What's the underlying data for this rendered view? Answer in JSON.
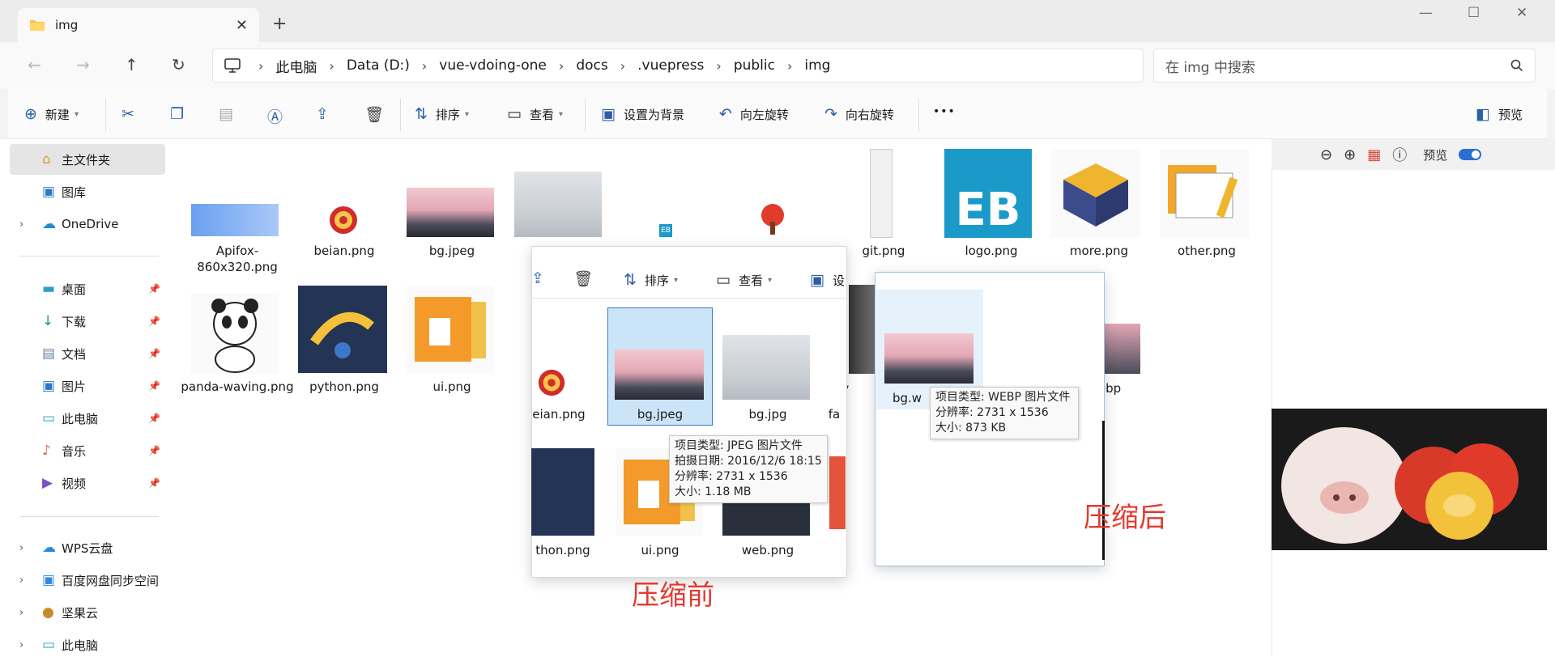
{
  "tab": {
    "title": "img"
  },
  "window_controls": {
    "minimize": "—",
    "maximize": "☐",
    "close": "✕"
  },
  "nav": {
    "back": "←",
    "forward": "→",
    "up": "↑",
    "refresh": "↻"
  },
  "breadcrumb": [
    "此电脑",
    "Data (D:)",
    "vue-vdoing-one",
    "docs",
    ".vuepress",
    "public",
    "img"
  ],
  "search": {
    "placeholder": "在 img 中搜索"
  },
  "toolbar": {
    "new_label": "新建",
    "sort_label": "排序",
    "view_label": "查看",
    "set_bg_label": "设置为背景",
    "rotate_left_label": "向左旋转",
    "rotate_right_label": "向右旋转",
    "more_label": "•••",
    "preview_label": "预览"
  },
  "sidebar": {
    "items": [
      {
        "label": "主文件夹",
        "icon": "home-icon",
        "glyph": "⌂"
      },
      {
        "label": "图库",
        "icon": "gallery-icon",
        "glyph": "▣"
      },
      {
        "label": "OneDrive",
        "icon": "cloud-icon",
        "glyph": "☁"
      },
      {
        "label": "桌面",
        "icon": "desktop-icon",
        "glyph": "▬"
      },
      {
        "label": "下载",
        "icon": "download-icon",
        "glyph": "↓"
      },
      {
        "label": "文档",
        "icon": "documents-icon",
        "glyph": "▤"
      },
      {
        "label": "图片",
        "icon": "pictures-icon",
        "glyph": "▣"
      },
      {
        "label": "此电脑",
        "icon": "computer-icon",
        "glyph": "▭"
      },
      {
        "label": "音乐",
        "icon": "music-icon",
        "glyph": "♪"
      },
      {
        "label": "视频",
        "icon": "video-icon",
        "glyph": "▶"
      },
      {
        "label": "WPS云盘",
        "icon": "wps-cloud-icon",
        "glyph": "☁"
      },
      {
        "label": "百度网盘同步空间",
        "icon": "baidu-sync-icon",
        "glyph": "▣"
      },
      {
        "label": "坚果云",
        "icon": "nutstore-icon",
        "glyph": "●"
      },
      {
        "label": "此电脑",
        "icon": "computer-icon",
        "glyph": "▭"
      }
    ]
  },
  "files_row1": [
    "Apifox-860x320.png",
    "beian.png",
    "bg.jpeg",
    "git.png",
    "logo.png",
    "more.png",
    "other.png"
  ],
  "files_row2": [
    "panda-waving.png",
    "python.png",
    "ui.png",
    "xyy",
    "ebp"
  ],
  "overlay_before": {
    "sort_label": "排序",
    "view_label": "查看",
    "cut_label": "设",
    "files": [
      "eian.png",
      "bg.jpeg",
      "bg.jpg",
      "fa",
      "thon.png",
      "ui.png",
      "web.png"
    ],
    "tooltip": [
      "项目类型: JPEG 图片文件",
      "拍摄日期: 2016/12/6 18:15",
      "分辨率: 2731 x 1536",
      "大小: 1.18 MB"
    ],
    "caption": "压缩前"
  },
  "overlay_after": {
    "file": "bg.w",
    "tooltip": [
      "项目类型: WEBP 图片文件",
      "分辨率: 2731 x 1536",
      "大小: 873 KB"
    ],
    "caption": "压缩后"
  },
  "preview_pane": {
    "toggle_label": "预览"
  },
  "thumb_labels": {
    "logo": "EB",
    "small_logo": "EB"
  },
  "colors": {
    "accent": "#2b5fa8",
    "selection": "#cce4f7",
    "caption_red": "#e23a30",
    "logo_bg": "#1b9ac9"
  }
}
